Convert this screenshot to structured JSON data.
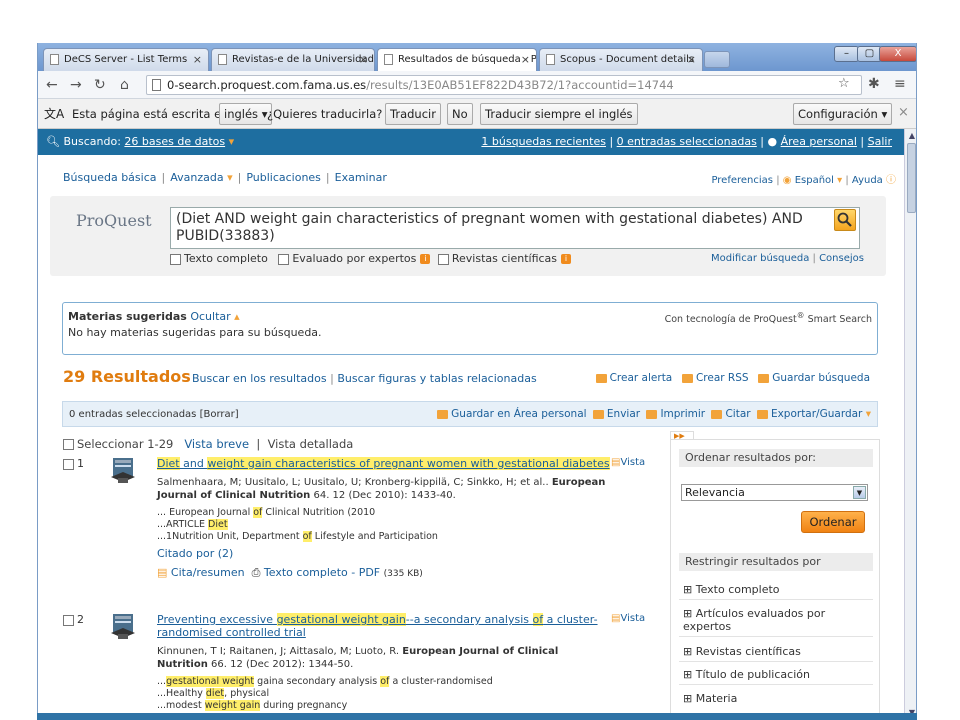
{
  "tabs": [
    {
      "title": "DeCS Server - List Terms"
    },
    {
      "title": "Revistas-e de la Universidad"
    },
    {
      "title": "Resultados de búsqueda - Pr"
    },
    {
      "title": "Scopus - Document details"
    }
  ],
  "window_buttons": {
    "minimize": "–",
    "maximize": "▢",
    "close": "X"
  },
  "address": {
    "host": "0-search.proquest.com.fama.us.es",
    "path": "/results/13E0AB51EF822D43B72/1?accountid=14744"
  },
  "translate": {
    "text1": "Esta página está escrita en",
    "lang": "inglés",
    "question": "¿Quieres traducirla?",
    "translate_btn": "Traducir",
    "no_btn": "No",
    "always_btn": "Traducir siempre el inglés",
    "config_btn": "Configuración"
  },
  "topbar": {
    "searching": "Buscando:",
    "databases": "26 bases de datos",
    "recent": "1 búsquedas recientes",
    "selected": "0 entradas seleccionadas",
    "personal": "Área personal",
    "exit": "Salir"
  },
  "nav": {
    "basic": "Búsqueda básica",
    "advanced": "Avanzada",
    "publications": "Publicaciones",
    "browse": "Examinar",
    "prefs": "Preferencias",
    "language": "Español",
    "help": "Ayuda"
  },
  "search": {
    "logo": "ProQuest",
    "query": "(Diet AND weight gain characteristics of pregnant women with gestational diabetes) AND PUBID(33883)",
    "full_text": "Texto completo",
    "peer": "Evaluado por expertos",
    "journals": "Revistas científicas",
    "modify": "Modificar búsqueda",
    "tips": "Consejos"
  },
  "suggested": {
    "label": "Materias sugeridas",
    "hide": "Ocultar",
    "none": "No hay materias sugeridas para su búsqueda.",
    "powered": "Con tecnología de ProQuest",
    "powered2": " Smart Search"
  },
  "results": {
    "count": "29 Resultados",
    "search_within": "Buscar en los resultados",
    "figures": "Buscar figuras y tablas relacionadas",
    "alert": "Crear alerta",
    "rss": "Crear RSS",
    "save_search": "Guardar búsqueda"
  },
  "selbar": {
    "text": "0 entradas seleccionadas [Borrar]",
    "save": "Guardar en Área personal",
    "send": "Enviar",
    "print": "Imprimir",
    "cite": "Citar",
    "export": "Exportar/Guardar"
  },
  "view": {
    "select": "Seleccionar 1-29",
    "brief": "Vista breve",
    "detailed": "Vista detallada"
  },
  "items": [
    {
      "num": "1",
      "vista": "Vista",
      "title_parts": [
        {
          "t": "Diet",
          "h": true
        },
        {
          "t": " and ",
          "h": false
        },
        {
          "t": "weight gain characteristics of pregnant women with gestational diabetes",
          "h": true
        }
      ],
      "authors": "Salmenhaara, M; Uusitalo, L; Uusitalo, U; Kronberg-kippilä, C; Sinkko, H; et al..",
      "journal": "European Journal of Clinical Nutrition",
      "vol": "64. 12  (Dec 2010): 1433-40.",
      "snippets": [
        [
          {
            "t": "... European Journal ",
            "h": false
          },
          {
            "t": "of",
            "h": true
          },
          {
            "t": " Clinical Nutrition (2010",
            "h": false
          }
        ],
        [
          {
            "t": "...ARTICLE ",
            "h": false
          },
          {
            "t": "Diet",
            "h": true
          }
        ],
        [
          {
            "t": "...1Nutrition Unit, Department ",
            "h": false
          },
          {
            "t": "of",
            "h": true
          },
          {
            "t": " Lifestyle and Participation",
            "h": false
          }
        ]
      ],
      "cited": "Citado por (2)",
      "abstract": "Cita/resumen",
      "fulltext": "Texto completo - PDF",
      "size": "(335 KB)"
    },
    {
      "num": "2",
      "vista": "Vista",
      "title_parts": [
        {
          "t": "Preventing excessive ",
          "h": false
        },
        {
          "t": "gestational weight gain",
          "h": true
        },
        {
          "t": "--a secondary analysis ",
          "h": false
        },
        {
          "t": "of",
          "h": true
        },
        {
          "t": " a cluster-randomised controlled trial",
          "h": false
        }
      ],
      "authors": "Kinnunen, T I; Raitanen, J; Aittasalo, M; Luoto, R.",
      "journal": "European Journal of Clinical Nutrition",
      "vol": "66. 12  (Dec 2012): 1344-50.",
      "snippets": [
        [
          {
            "t": "...",
            "h": false
          },
          {
            "t": "gestational weight",
            "h": true
          },
          {
            "t": " gaina secondary analysis ",
            "h": false
          },
          {
            "t": "of",
            "h": true
          },
          {
            "t": " a cluster-randomised",
            "h": false
          }
        ],
        [
          {
            "t": "...Healthy ",
            "h": false
          },
          {
            "t": "diet",
            "h": true
          },
          {
            "t": ", physical",
            "h": false
          }
        ],
        [
          {
            "t": "...modest ",
            "h": false
          },
          {
            "t": "weight gain",
            "h": true
          },
          {
            "t": " during pregnancy",
            "h": false
          }
        ]
      ]
    }
  ],
  "sidebar": {
    "sort_label": "Ordenar resultados por:",
    "sort_value": "Relevancia",
    "sort_btn": "Ordenar",
    "restrict": "Restringir resultados por",
    "filters": [
      "Texto completo",
      "Artículos evaluados por expertos",
      "Revistas científicas",
      "Título de publicación",
      "Materia"
    ]
  }
}
